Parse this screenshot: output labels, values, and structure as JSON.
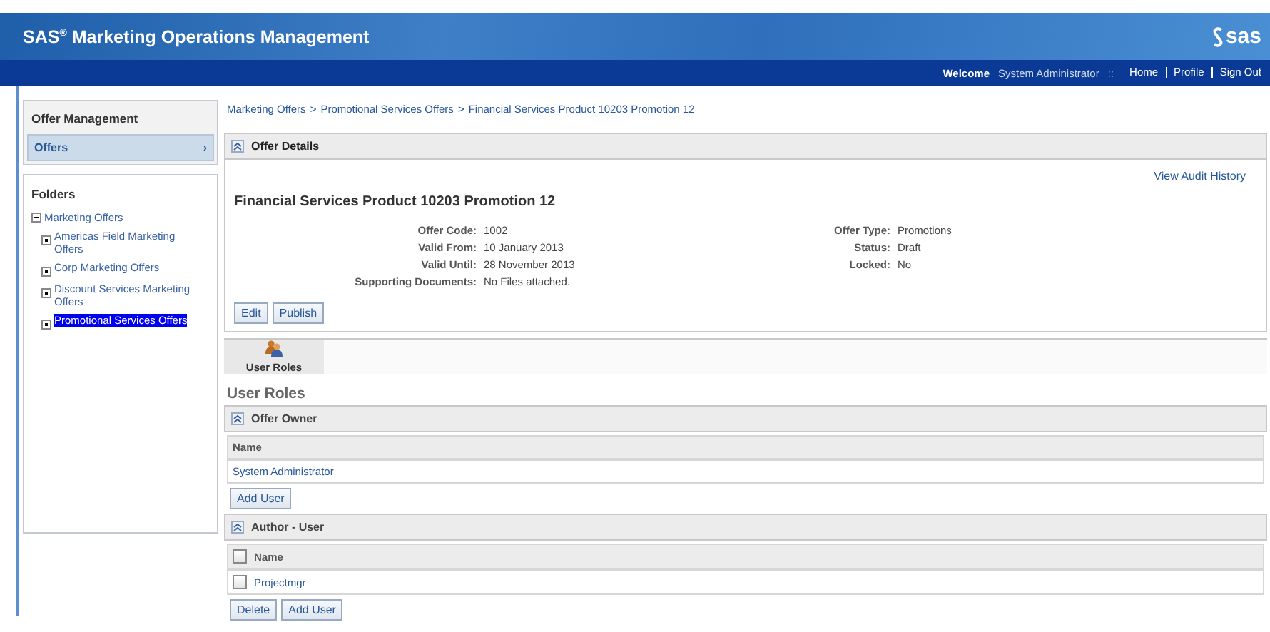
{
  "header": {
    "title": "SAS$^{®}$ Marketing Operations Management",
    "logo": "sas"
  },
  "nav": {
    "welcome": "Welcome",
    "user": "System Administrator",
    "separator": "::",
    "links": [
      "Home",
      "Profile",
      "Sign Out"
    ]
  },
  "sidebar": {
    "offer_management": {
      "title": "Offer Management",
      "items": [
        {
          "label": "Offers",
          "arrow": "›",
          "selected": true
        }
      ]
    },
    "folders": {
      "title": "Folders",
      "tree": [
        {
          "label": "Marketing Offers",
          "expanded": true,
          "selected": false,
          "children": [
            {
              "label": "Americas Field Marketing Offers",
              "expanded": false,
              "selected": false
            },
            {
              "label": "Corp Marketing Offers",
              "expanded": false,
              "selected": false
            },
            {
              "label": "Discount Services Marketing Offers",
              "expanded": false,
              "selected": false
            },
            {
              "label": "Promotional Services Offers",
              "expanded": false,
              "selected": true
            }
          ]
        }
      ]
    }
  },
  "breadcrumb": {
    "separator": ">",
    "items": [
      "Marketing Offers",
      "Promotional Services Offers",
      "Financial Services Product 10203 Promotion 12"
    ]
  },
  "offer_details": {
    "title": "Offer Details",
    "audit_link": "View Audit History",
    "heading": "Financial Services Product 10203 Promotion 12",
    "fields_left": [
      {
        "label": "Offer Code:",
        "value": "1002"
      },
      {
        "label": "Valid From:",
        "value": "10 January 2013"
      },
      {
        "label": "Valid Until:",
        "value": "28 November 2013"
      },
      {
        "label": "Supporting Documents:",
        "value": "No Files attached."
      }
    ],
    "fields_right": [
      {
        "label": "Offer Type:",
        "value": "Promotions"
      },
      {
        "label": "Status:",
        "value": "Draft"
      },
      {
        "label": "Locked:",
        "value": "No"
      }
    ],
    "buttons": [
      "Edit",
      "Publish"
    ]
  },
  "tabs": [
    {
      "label": "User Roles",
      "selected": true
    }
  ],
  "user_roles": {
    "title": "User Roles",
    "groups": [
      {
        "title": "Offer Owner",
        "selectable": false,
        "column": "Name",
        "rows": [
          {
            "name": "System Administrator"
          }
        ],
        "buttons": [
          "Add User"
        ]
      },
      {
        "title": "Author - User",
        "selectable": true,
        "header_checked": false,
        "column": "Name",
        "rows": [
          {
            "name": "Projectmgr",
            "checked": false
          }
        ],
        "buttons": [
          "Delete",
          "Add User"
        ]
      }
    ]
  }
}
